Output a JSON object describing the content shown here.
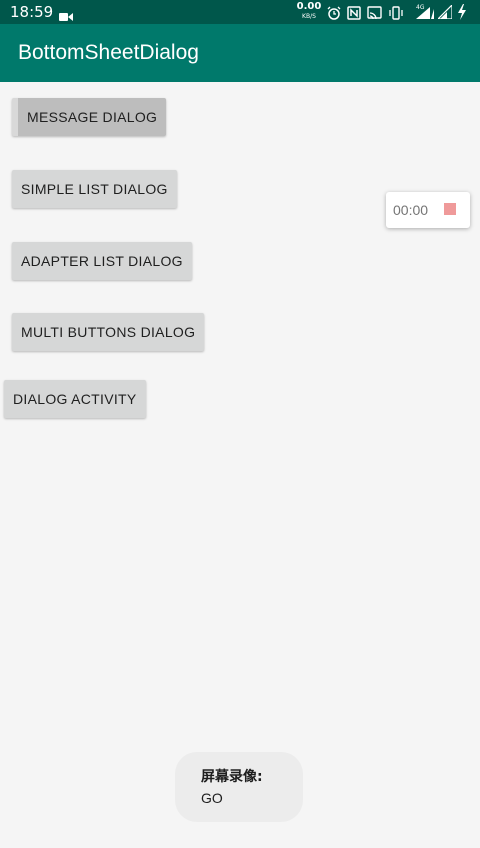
{
  "status_bar": {
    "time": "18:59",
    "net_speed_value": "0.00",
    "net_speed_unit": "KB/S",
    "network_type": "4G",
    "icons": [
      "video-record-icon",
      "alarm-icon",
      "nfc-icon",
      "cast-icon",
      "vibrate-icon",
      "signal-icon",
      "battery-charging-icon"
    ]
  },
  "app_bar": {
    "title": "BottomSheetDialog",
    "color": "#00796b"
  },
  "buttons": {
    "message_dialog": "MESSAGE DIALOG",
    "simple_list_dialog": "SIMPLE LIST DIALOG",
    "adapter_list_dialog": "ADAPTER LIST DIALOG",
    "multi_buttons_dialog": "MULTI BUTTONS DIALOG",
    "dialog_activity": "DIALOG ACTIVITY"
  },
  "recorder": {
    "elapsed": "00:00",
    "stop_color": "#ef9a9a"
  },
  "toast": {
    "line1": "屏幕录像:",
    "line2": "GO"
  }
}
